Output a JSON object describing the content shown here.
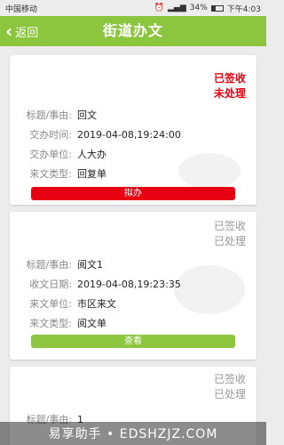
{
  "status_bar": {
    "carrier": "中国移动",
    "battery": "34%",
    "battery_level": 0.34,
    "time": "下午4:03"
  },
  "header": {
    "back_label": "返回",
    "title": "街道办文"
  },
  "cards": [
    {
      "status_line1": "已签收",
      "status_line2": "未处理",
      "rows": [
        {
          "label": "标题/事由:",
          "value": "回文"
        },
        {
          "label": "交办时间:",
          "value": "2019-04-08,19:24:00"
        },
        {
          "label": "交办单位:",
          "value": "人大办"
        },
        {
          "label": "来文类型:",
          "value": "回复单"
        }
      ],
      "action_label": "拟办"
    },
    {
      "status_line1": "已签收",
      "status_line2": "已处理",
      "rows": [
        {
          "label": "标题/事由:",
          "value": "阅文1"
        },
        {
          "label": "收文日期:",
          "value": "2019-04-08,19:23:35"
        },
        {
          "label": "来文单位:",
          "value": "市区来文"
        },
        {
          "label": "来文类型:",
          "value": "阅文单"
        }
      ],
      "action_label": "查看"
    },
    {
      "status_line1": "已签收",
      "status_line2": "已处理",
      "rows": [
        {
          "label": "标题/事由:",
          "value": "1"
        }
      ]
    }
  ],
  "watermark": "易享助手 • EDSHZJZ.COM",
  "colors": {
    "accent_green": "#8cc63e",
    "alert_red": "#e60012",
    "muted_gray": "#9a9a9a"
  }
}
